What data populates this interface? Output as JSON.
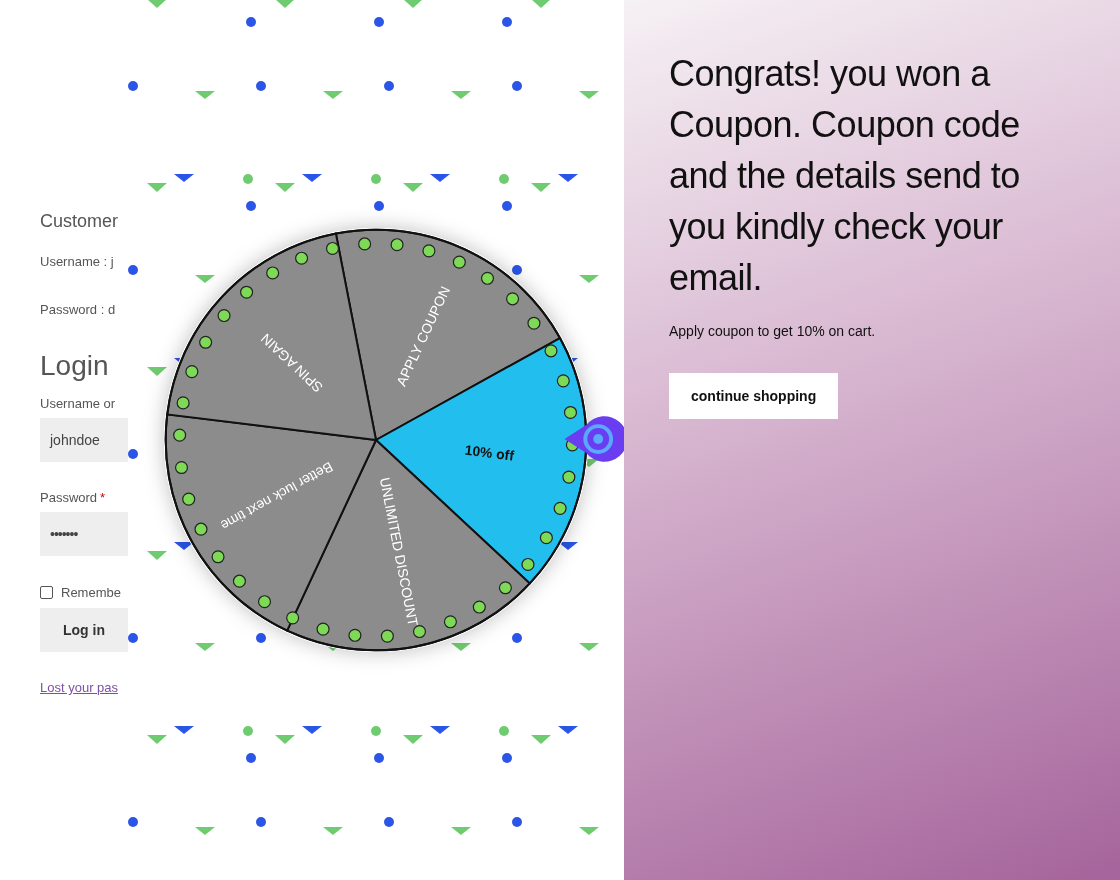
{
  "login_page": {
    "section_title": "Customer",
    "info_lines": [
      "Username : j",
      "Password : d"
    ],
    "heading": "Login",
    "username": {
      "label": "Username or",
      "value": "johndoe"
    },
    "password": {
      "label": "Password",
      "required_mark": "*",
      "value": "•••••••"
    },
    "remember": {
      "label": "Remembe",
      "checked": false
    },
    "login_button": "Log in",
    "lost_password_link": "Lost your pas"
  },
  "wheel": {
    "segments": [
      {
        "label": "APPLY COUPON",
        "color": "#8c8c8c",
        "selected": false
      },
      {
        "label": "10% off",
        "color": "#22bfee",
        "selected": true
      },
      {
        "label": "UNLIMITED DISCOUNT",
        "color": "#8c8c8c",
        "selected": false
      },
      {
        "label": "Better luck next time",
        "color": "#8c8c8c",
        "selected": false
      },
      {
        "label": "SPIN AGAIN",
        "color": "#8c8c8c",
        "selected": false
      }
    ]
  },
  "result": {
    "heading": "Congrats! you won a Coupon. Coupon code and the details send to you kindly check your email.",
    "text": "Apply coupon to get 10% on cart.",
    "button": "continue shopping"
  }
}
